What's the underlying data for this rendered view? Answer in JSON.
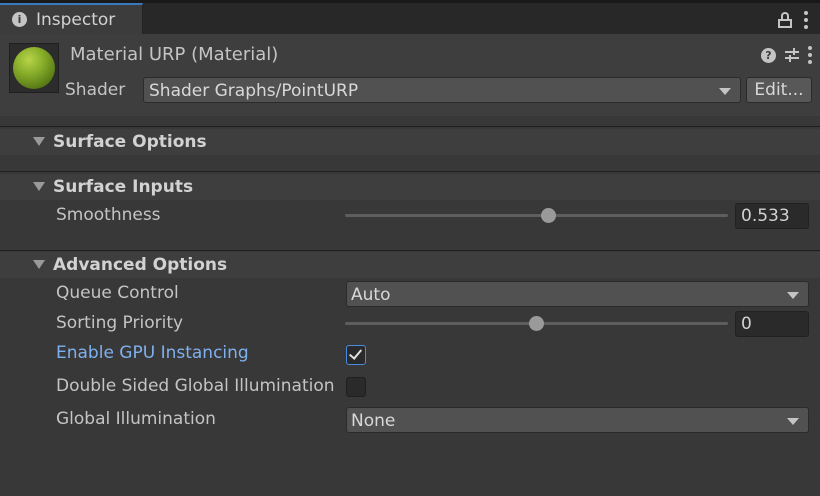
{
  "tab": {
    "icon": "info-icon",
    "label": "Inspector"
  },
  "tab_actions": {
    "lock_icon": "lock-icon",
    "menu_icon": "kebab-menu-icon"
  },
  "header": {
    "title": "Material URP (Material)",
    "icons": [
      "help-icon",
      "preset-icon",
      "kebab-menu-icon"
    ],
    "shader_label": "Shader",
    "shader_value": "Shader Graphs/PointURP",
    "edit_label": "Edit...",
    "preview_color": "#8ab02b"
  },
  "sections": {
    "surface_options": {
      "label": "Surface Options",
      "expanded": true
    },
    "surface_inputs": {
      "label": "Surface Inputs",
      "expanded": true,
      "smoothness": {
        "label": "Smoothness",
        "value": "0.533",
        "fraction": 0.533
      }
    },
    "advanced_options": {
      "label": "Advanced Options",
      "expanded": true,
      "queue_control": {
        "label": "Queue Control",
        "value": "Auto"
      },
      "sorting_priority": {
        "label": "Sorting Priority",
        "value": "0",
        "fraction": 0.5
      },
      "gpu_instancing": {
        "label": "Enable GPU Instancing",
        "checked": true
      },
      "double_sided_gi": {
        "label": "Double Sided Global Illumination",
        "checked": false
      },
      "global_illumination": {
        "label": "Global Illumination",
        "value": "None"
      }
    }
  },
  "colors": {
    "accent": "#3a79bb",
    "highlight_label": "#7fb0ef",
    "panel": "#383838"
  }
}
